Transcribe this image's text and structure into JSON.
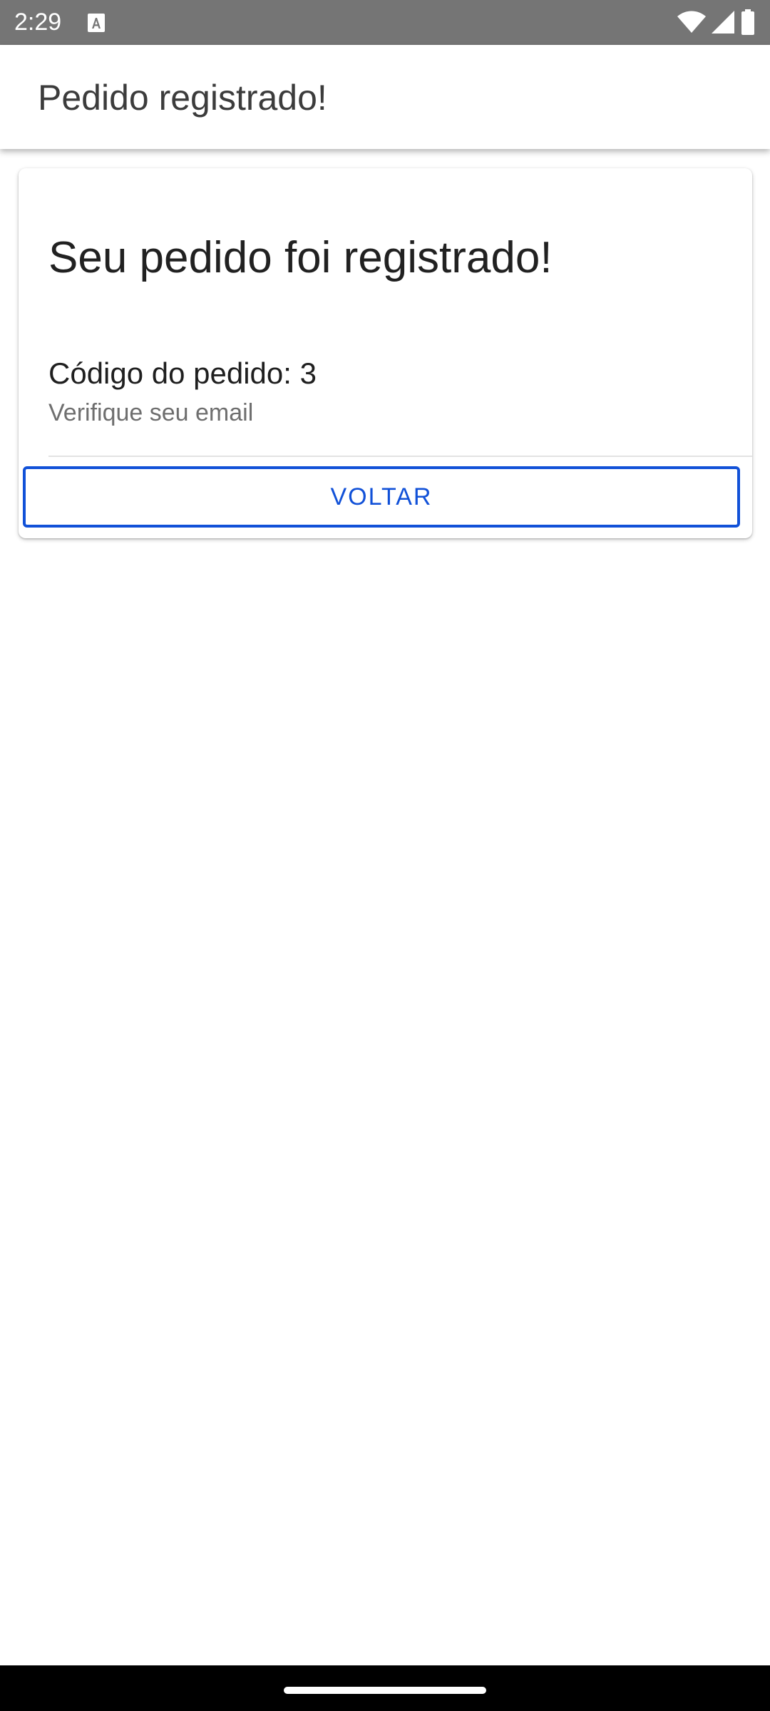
{
  "status_bar": {
    "time": "2:29",
    "icons": [
      "text-a-icon",
      "wifi-icon",
      "signal-icon",
      "battery-icon"
    ]
  },
  "app_bar": {
    "title": "Pedido registrado!"
  },
  "card": {
    "title": "Seu pedido foi registrado!",
    "order_code": "Código do pedido: 3",
    "hint": "Verifique seu email",
    "back_label": "VOLTAR"
  },
  "colors": {
    "accent": "#1151d8",
    "status_bar": "#757575",
    "nav_bar": "#000000"
  }
}
